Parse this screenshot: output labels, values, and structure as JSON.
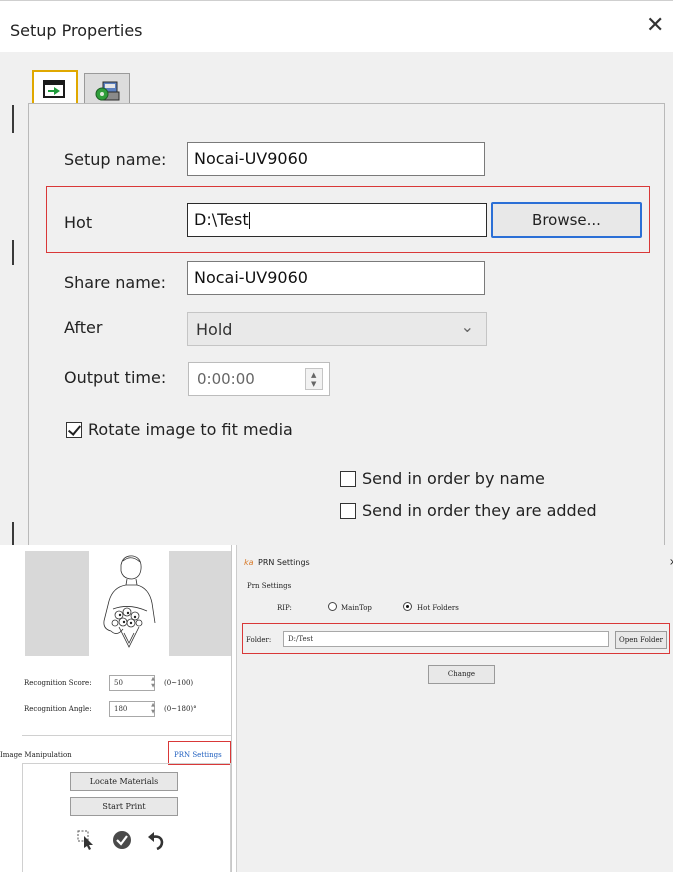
{
  "setup_dialog": {
    "title": "Setup Properties",
    "close_glyph": "✕",
    "setup_name": {
      "label": "Setup name:",
      "value": "Nocai-UV9060"
    },
    "hot": {
      "label": "Hot",
      "value": "D:\\Test",
      "browse_label": "Browse..."
    },
    "share_name": {
      "label": "Share name:",
      "value": "Nocai-UV9060"
    },
    "after": {
      "label": "After",
      "selected": "Hold"
    },
    "output_time": {
      "label": "Output time:",
      "value": "0:00:00"
    },
    "rotate": {
      "label": "Rotate image to fit media",
      "checked": true
    },
    "send_by_name": {
      "label": "Send in order by name",
      "checked": false
    },
    "send_by_added": {
      "label": "Send in order they are added",
      "checked": false
    }
  },
  "left_app": {
    "recognition_score": {
      "label": "Recognition Score:",
      "value": "50",
      "range": "(0~100)"
    },
    "recognition_angle": {
      "label": "Recognition Angle:",
      "value": "180",
      "range": "(0~180)°"
    },
    "image_manipulation": "Image Manipulation",
    "prn_settings_link": "PRN Settings",
    "locate_materials": "Locate Materials",
    "start_print": "Start Print"
  },
  "prn_window": {
    "title": "PRN Settings",
    "group_title": "Prn Settings",
    "rip_label": "RIP:",
    "options": [
      "MainTop",
      "Hot Folders"
    ],
    "selected_option": "Hot Folders",
    "folder_label": "Folder:",
    "folder_value": "D:/Test",
    "open_folder": "Open Folder",
    "change": "Change",
    "close_glyph": "×"
  },
  "colors": {
    "highlight_red": "#d93838",
    "focus_blue": "#2b6fd6",
    "link_blue": "#1f5fbf"
  }
}
